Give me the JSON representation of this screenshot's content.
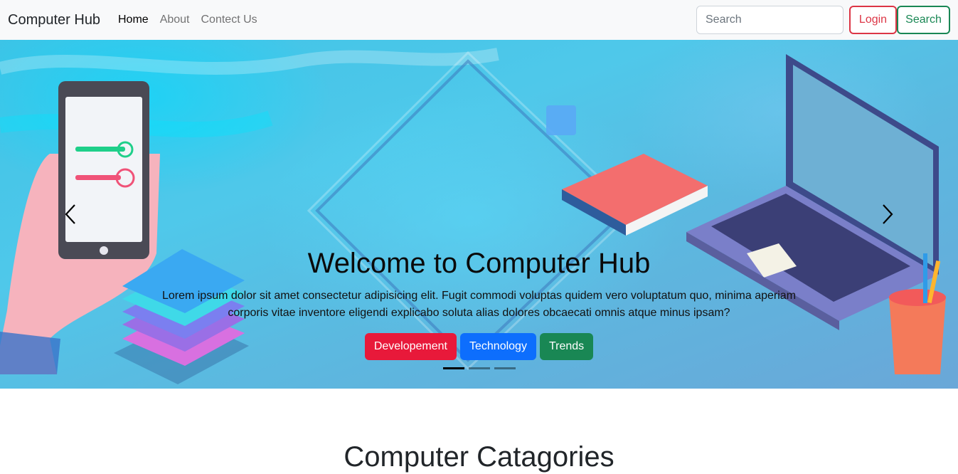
{
  "navbar": {
    "brand": "Computer Hub",
    "links": [
      {
        "label": "Home"
      },
      {
        "label": "About"
      },
      {
        "label": "Contect Us"
      }
    ],
    "search_placeholder": "Search",
    "login_label": "Login",
    "search_label": "Search"
  },
  "hero": {
    "title": "Welcome to Computer Hub",
    "text": "Lorem ipsum dolor sit amet consectetur adipisicing elit. Fugit commodi voluptas quidem vero voluptatum quo, minima aperiam corporis vitae inventore eligendi explicabo soluta alias dolores obcaecati omnis atque minus ipsam?",
    "buttons": [
      {
        "label": "Developement",
        "color": "#e8193a"
      },
      {
        "label": "Technology",
        "color": "#0d6efd"
      },
      {
        "label": "Trends",
        "color": "#198754"
      }
    ],
    "active_slide": 1,
    "slide_count": 3
  },
  "section": {
    "title": "Computer Catagories"
  },
  "colors": {
    "danger": "#dc3545",
    "success": "#198754",
    "primary": "#0d6efd",
    "navbar_bg": "#f8f9fa"
  },
  "icons": {
    "prev": "chevron-left-icon",
    "next": "chevron-right-icon"
  }
}
